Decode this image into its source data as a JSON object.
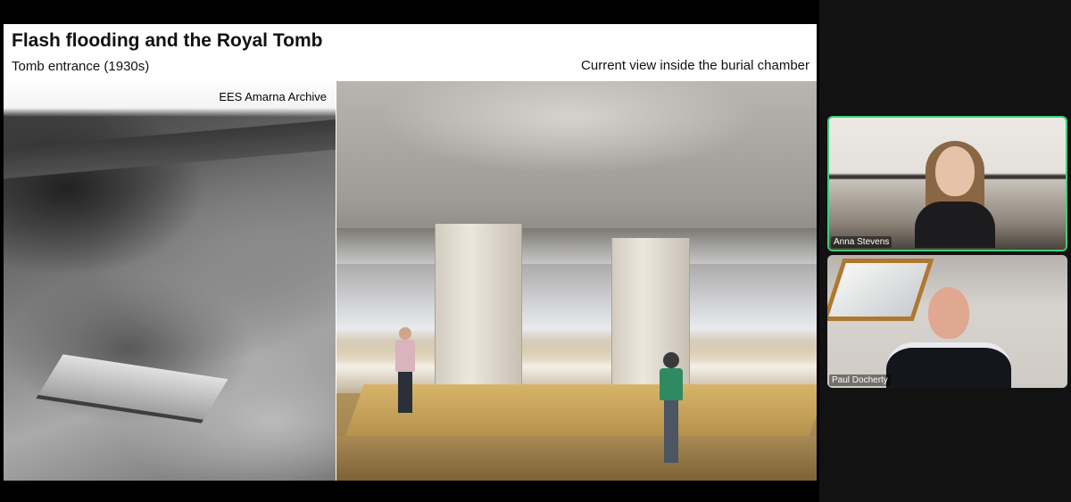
{
  "slide": {
    "title": "Flash flooding and the Royal Tomb",
    "left_caption": "Tomb entrance (1930s)",
    "right_caption": "Current view inside the burial chamber",
    "archive_credit": "EES Amarna Archive"
  },
  "participants": [
    {
      "name": "Anna Stevens",
      "active_speaker": true
    },
    {
      "name": "Paul Docherty",
      "active_speaker": false
    }
  ],
  "colors": {
    "active_speaker_border": "#3fcf78",
    "background": "#121212"
  }
}
